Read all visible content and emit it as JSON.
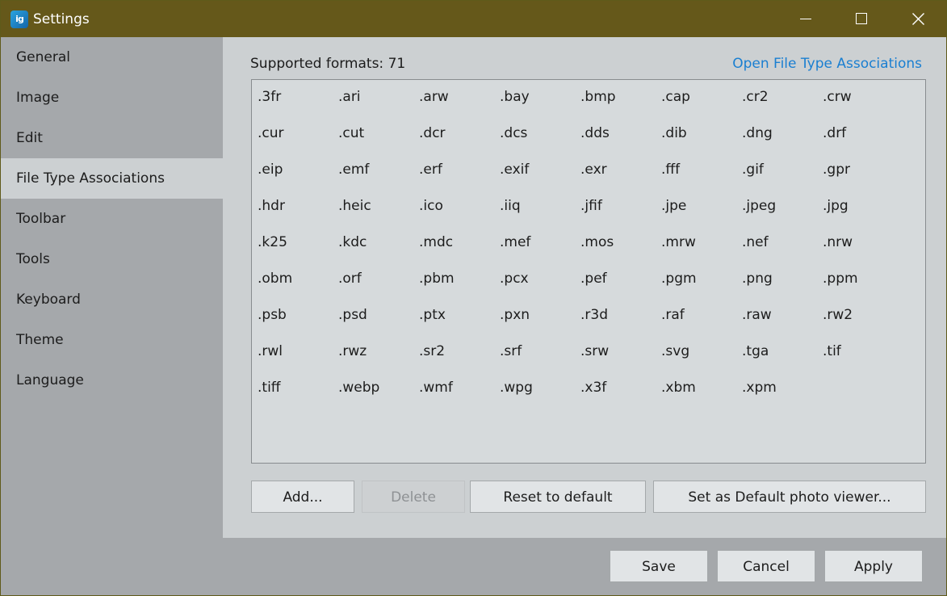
{
  "window": {
    "title": "Settings",
    "icon_label": "ig",
    "icon_name": "app-icon",
    "controls": [
      "minimize-icon",
      "maximize-icon",
      "close-icon"
    ]
  },
  "colors": {
    "titlebar": "#65581a",
    "sidebar": "#a5a8ab",
    "panel": "#ccd0d2",
    "link": "#1a7fd1"
  },
  "sidebar": {
    "items": [
      {
        "label": "General",
        "active": false
      },
      {
        "label": "Image",
        "active": false
      },
      {
        "label": "Edit",
        "active": false
      },
      {
        "label": "File Type Associations",
        "active": true
      },
      {
        "label": "Toolbar",
        "active": false
      },
      {
        "label": "Tools",
        "active": false
      },
      {
        "label": "Keyboard",
        "active": false
      },
      {
        "label": "Theme",
        "active": false
      },
      {
        "label": "Language",
        "active": false
      }
    ]
  },
  "main": {
    "formats_label": "Supported formats: 71",
    "associations_link": "Open File Type Associations",
    "formats": [
      ".3fr",
      ".ari",
      ".arw",
      ".bay",
      ".bmp",
      ".cap",
      ".cr2",
      ".crw",
      ".cur",
      ".cut",
      ".dcr",
      ".dcs",
      ".dds",
      ".dib",
      ".dng",
      ".drf",
      ".eip",
      ".emf",
      ".erf",
      ".exif",
      ".exr",
      ".fff",
      ".gif",
      ".gpr",
      ".hdr",
      ".heic",
      ".ico",
      ".iiq",
      ".jfif",
      ".jpe",
      ".jpeg",
      ".jpg",
      ".k25",
      ".kdc",
      ".mdc",
      ".mef",
      ".mos",
      ".mrw",
      ".nef",
      ".nrw",
      ".obm",
      ".orf",
      ".pbm",
      ".pcx",
      ".pef",
      ".pgm",
      ".png",
      ".ppm",
      ".psb",
      ".psd",
      ".ptx",
      ".pxn",
      ".r3d",
      ".raf",
      ".raw",
      ".rw2",
      ".rwl",
      ".rwz",
      ".sr2",
      ".srf",
      ".srw",
      ".svg",
      ".tga",
      ".tif",
      ".tiff",
      ".webp",
      ".wmf",
      ".wpg",
      ".x3f",
      ".xbm",
      ".xpm"
    ],
    "buttons": {
      "add": "Add...",
      "delete": "Delete",
      "reset": "Reset to default",
      "set_default": "Set as Default photo viewer..."
    }
  },
  "footer": {
    "save": "Save",
    "cancel": "Cancel",
    "apply": "Apply"
  }
}
